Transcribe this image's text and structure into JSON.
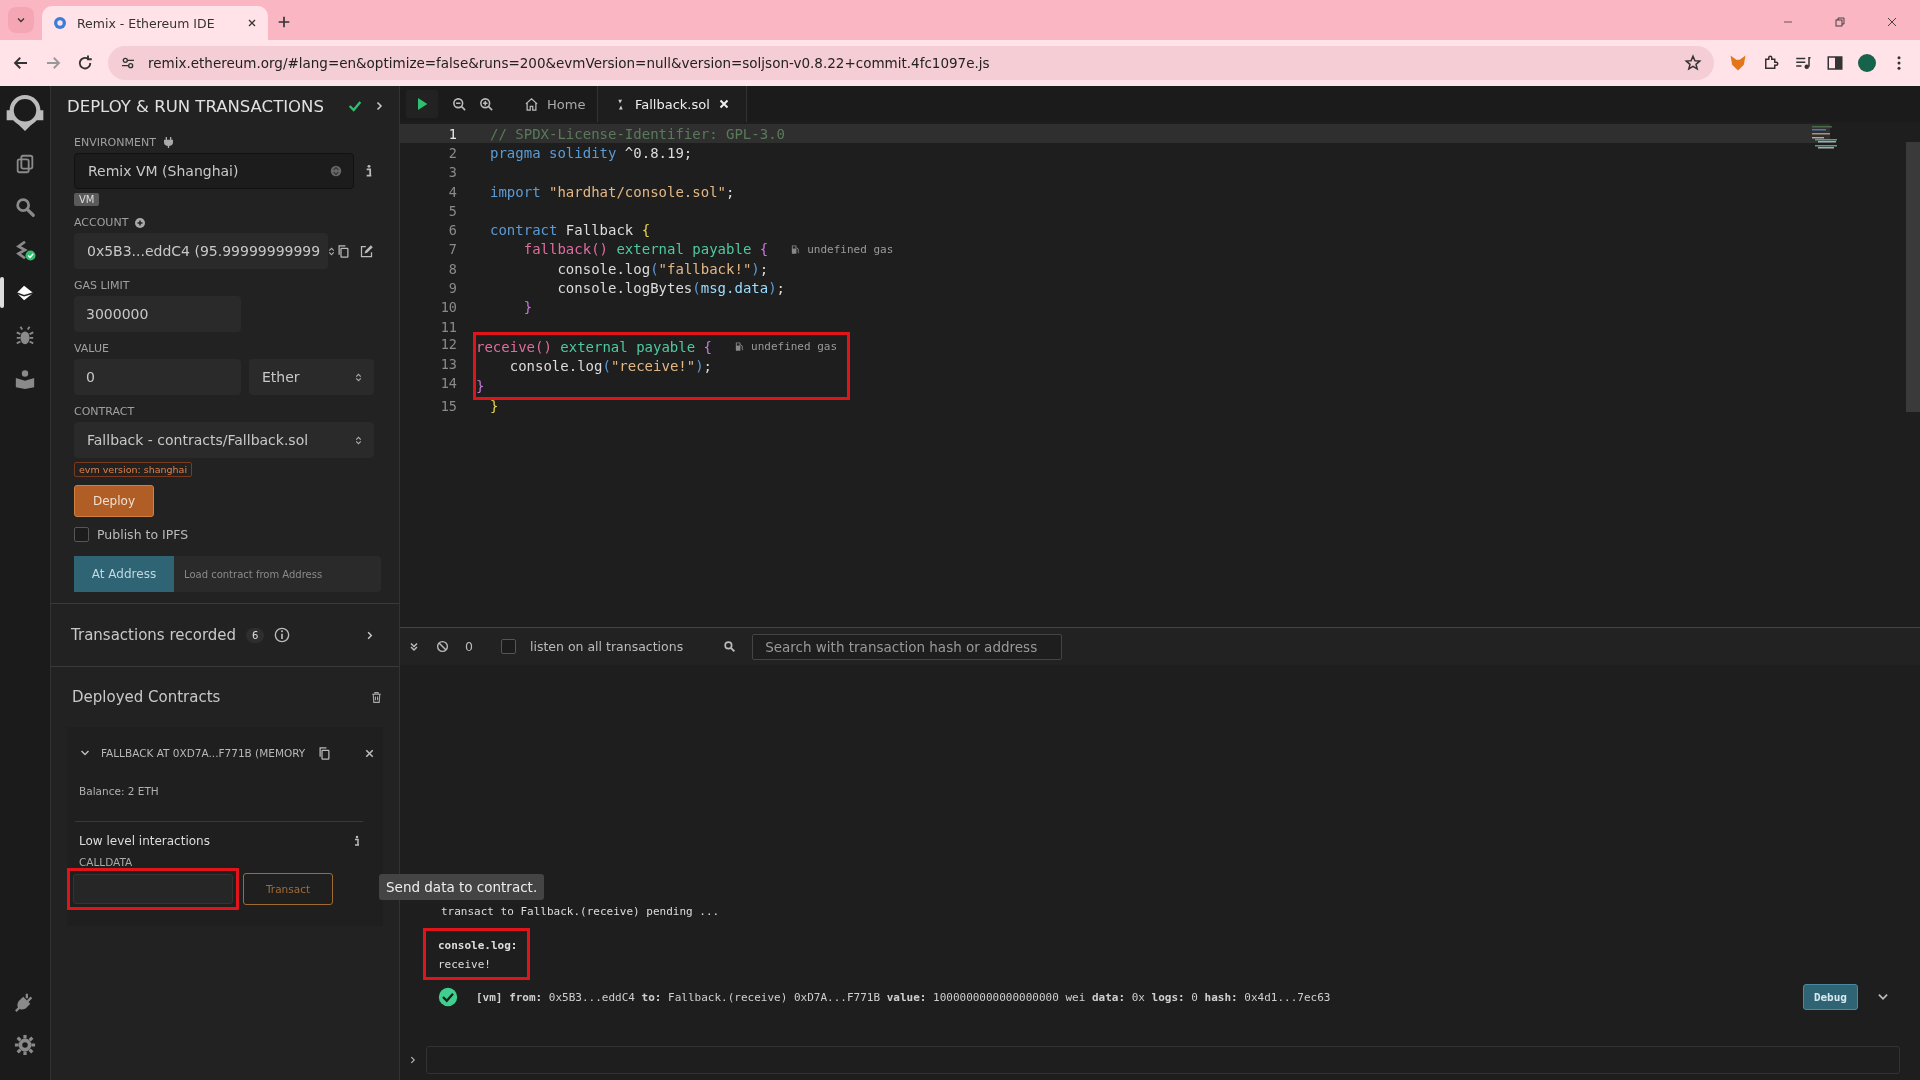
{
  "browser": {
    "tab_title": "Remix - Ethereum IDE",
    "url": "remix.ethereum.org/#lang=en&optimize=false&runs=200&evmVersion=null&version=soljson-v0.8.22+commit.4fc1097e.js"
  },
  "icon_rail": {
    "items": [
      {
        "kind": "files",
        "selected": false
      },
      {
        "kind": "search",
        "selected": false
      },
      {
        "kind": "compiler",
        "selected": false
      },
      {
        "kind": "deploy",
        "selected": true
      },
      {
        "kind": "debugger",
        "selected": false
      },
      {
        "kind": "learn",
        "selected": false
      }
    ],
    "bottom_items": [
      {
        "kind": "plugins",
        "selected": false
      },
      {
        "kind": "settings",
        "selected": false
      }
    ]
  },
  "panel": {
    "title": "DEPLOY & RUN TRANSACTIONS",
    "environment": {
      "label": "ENVIRONMENT",
      "value": "Remix VM (Shanghai)",
      "badge": "VM"
    },
    "account": {
      "label": "ACCOUNT",
      "value": "0x5B3...eddC4 (95.99999999999"
    },
    "gas_limit": {
      "label": "GAS LIMIT",
      "value": "3000000"
    },
    "value": {
      "label": "VALUE",
      "value": "0",
      "unit": "Ether"
    },
    "contract": {
      "label": "CONTRACT",
      "value": "Fallback - contracts/Fallback.sol",
      "evm_badge": "evm version: shanghai"
    },
    "deploy_button": "Deploy",
    "publish": {
      "label": "Publish to IPFS",
      "checked": false
    },
    "at_address": {
      "button": "At Address",
      "placeholder": "Load contract from Address"
    },
    "transactions_recorded": {
      "label": "Transactions recorded",
      "count": "6"
    },
    "deployed": {
      "title": "Deployed Contracts",
      "contracts": [
        {
          "name": "FALLBACK AT 0XD7A...F771B (MEMORY",
          "expanded": true,
          "balance": "Balance: 2 ETH",
          "low_level_title": "Low level interactions",
          "calldata_label": "CALLDATA",
          "calldata_highlighted": true,
          "button": "Transact",
          "tooltip": "Send data to contract."
        }
      ]
    }
  },
  "editor": {
    "tabs": [
      {
        "label": "Home",
        "kind": "home",
        "selected": false
      },
      {
        "label": "Fallback.sol",
        "kind": "file",
        "selected": true
      }
    ],
    "lines": [
      {
        "number": "1",
        "current": true,
        "highlighted": false,
        "tokens": [
          {
            "t": "// SPDX-License-Identifier: GPL-3.0",
            "kind": "comment"
          }
        ]
      },
      {
        "number": "2",
        "current": false,
        "highlighted": false,
        "tokens": [
          {
            "t": "pragma solidity",
            "kind": "keyword"
          },
          {
            "t": " ^0.8.19;",
            "kind": "plain"
          }
        ]
      },
      {
        "number": "3",
        "current": false,
        "highlighted": false
      },
      {
        "number": "4",
        "current": false,
        "highlighted": false,
        "tokens": [
          {
            "t": "import",
            "kind": "keyword"
          },
          {
            "t": " \"hardhat/console.sol\"",
            "kind": "string"
          },
          {
            "t": ";",
            "kind": "plain"
          }
        ]
      },
      {
        "number": "5",
        "current": false,
        "highlighted": false
      },
      {
        "number": "6",
        "current": false,
        "highlighted": false,
        "tokens": [
          {
            "t": "contract",
            "kind": "keyword"
          },
          {
            "t": " Fallback ",
            "kind": "plain"
          },
          {
            "t": "{",
            "kind": "brace"
          }
        ]
      },
      {
        "number": "7",
        "current": false,
        "highlighted": false,
        "gas": "undefined gas",
        "tokens": [
          {
            "t": "    fallback()",
            "kind": "function"
          },
          {
            "t": " external payable ",
            "kind": "modifier"
          },
          {
            "t": "{",
            "kind": "brace2"
          }
        ]
      },
      {
        "number": "8",
        "current": false,
        "highlighted": false,
        "tokens": [
          {
            "t": "        console.log",
            "kind": "plain"
          },
          {
            "t": "(",
            "kind": "paren"
          },
          {
            "t": "\"fallback!\"",
            "kind": "string"
          },
          {
            "t": ")",
            "kind": "paren"
          },
          {
            "t": ";",
            "kind": "plain"
          }
        ]
      },
      {
        "number": "9",
        "current": false,
        "highlighted": false,
        "tokens": [
          {
            "t": "        console.logBytes",
            "kind": "plain"
          },
          {
            "t": "(",
            "kind": "paren"
          },
          {
            "t": "msg.data",
            "kind": "variable"
          },
          {
            "t": ")",
            "kind": "paren"
          },
          {
            "t": ";",
            "kind": "plain"
          }
        ]
      },
      {
        "number": "10",
        "current": false,
        "highlighted": false,
        "tokens": [
          {
            "t": "    }",
            "kind": "brace2"
          }
        ]
      },
      {
        "number": "11",
        "current": false,
        "highlighted": false
      },
      {
        "number": "12",
        "current": false,
        "highlighted": true,
        "gas": "undefined gas",
        "tokens": [
          {
            "t": "    receive()",
            "kind": "function"
          },
          {
            "t": " external payable ",
            "kind": "modifier"
          },
          {
            "t": "{",
            "kind": "brace2"
          }
        ]
      },
      {
        "number": "13",
        "current": false,
        "highlighted": true,
        "tokens": [
          {
            "t": "        console.log",
            "kind": "plain"
          },
          {
            "t": "(",
            "kind": "paren"
          },
          {
            "t": "\"receive!\"",
            "kind": "string"
          },
          {
            "t": ")",
            "kind": "paren"
          },
          {
            "t": ";",
            "kind": "plain"
          }
        ]
      },
      {
        "number": "14",
        "current": false,
        "highlighted": true,
        "tokens": [
          {
            "t": "    }",
            "kind": "brace2"
          }
        ]
      },
      {
        "number": "15",
        "current": false,
        "highlighted": false,
        "tokens": [
          {
            "t": "}",
            "kind": "brace"
          }
        ]
      }
    ]
  },
  "terminal": {
    "pending_count": "0",
    "listen": {
      "label": "listen on all transactions",
      "checked": false
    },
    "search_placeholder": "Search with transaction hash or address",
    "entries": [
      {
        "kind": "info",
        "text": "transact to Fallback.(receive) pending ..."
      },
      {
        "kind": "log",
        "title": "console.log:",
        "text": "receive!",
        "highlighted": true
      },
      {
        "kind": "tx",
        "text": "**[vm]**  **from:** 0x5B3...eddC4 **to:** Fallback.(receive) 0xD7A...F771B **value:** 1000000000000000000 wei **data:** 0x **logs:** 0 **hash:** 0x4d1...7ec63",
        "button": "Debug"
      }
    ]
  }
}
